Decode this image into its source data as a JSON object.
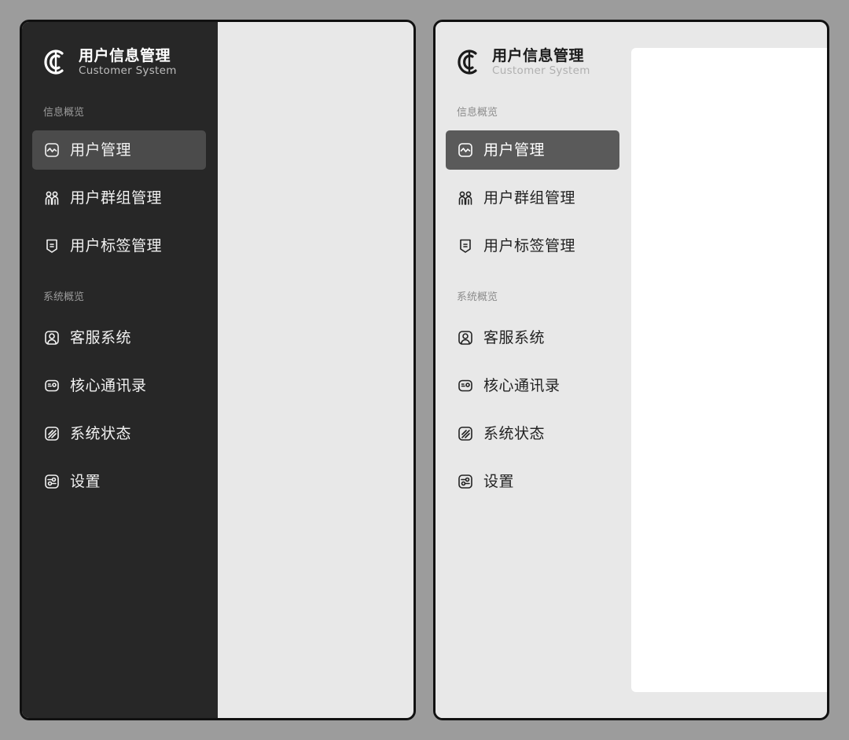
{
  "app": {
    "title": "用户信息管理",
    "subtitle": "Customer System"
  },
  "sections": [
    {
      "label": "信息概览",
      "items": [
        {
          "label": "用户管理",
          "icon": "activity-icon",
          "active": true
        },
        {
          "label": "用户群组管理",
          "icon": "users-icon",
          "active": false
        },
        {
          "label": "用户标签管理",
          "icon": "tag-icon",
          "active": false
        }
      ]
    },
    {
      "label": "系统概览",
      "items": [
        {
          "label": "客服系统",
          "icon": "person-icon",
          "active": false
        },
        {
          "label": "核心通讯录",
          "icon": "contact-card-icon",
          "active": false
        },
        {
          "label": "系统状态",
          "icon": "status-icon",
          "active": false
        },
        {
          "label": "设置",
          "icon": "settings-icon",
          "active": false
        }
      ]
    }
  ],
  "colors": {
    "dark_sidebar": "#272727",
    "dark_active": "#4b4b4b",
    "light_sidebar": "#e8e8e8",
    "light_active": "#5a5a5a",
    "background": "#9c9c9c"
  }
}
